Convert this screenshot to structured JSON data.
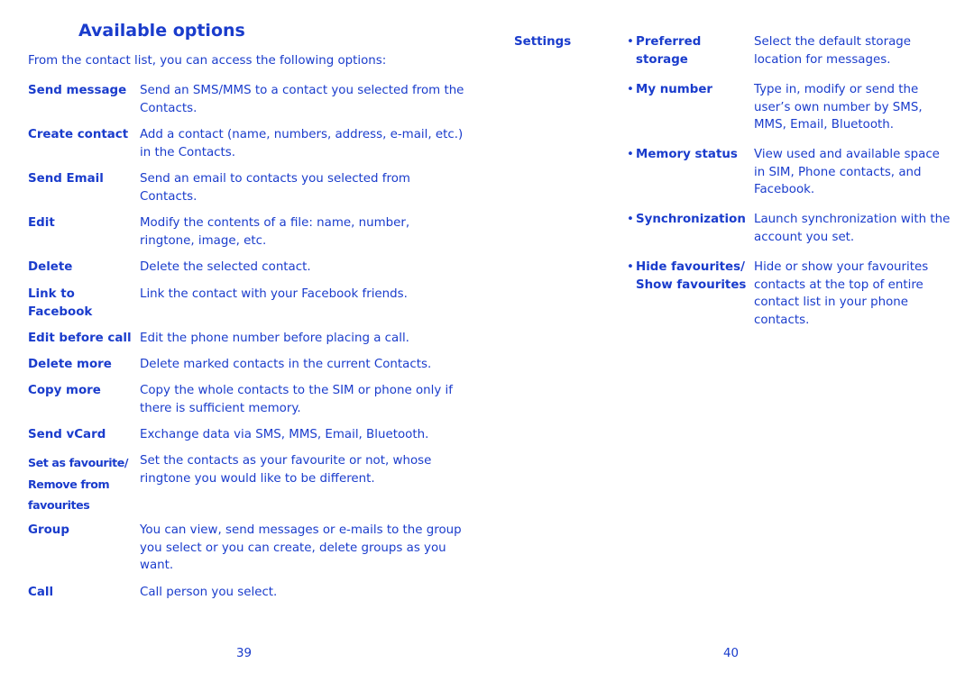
{
  "left_page": {
    "title": "Available options",
    "intro": "From the contact list, you can access the following options:",
    "options": [
      {
        "label": "Send message",
        "desc": "Send an SMS/MMS to a contact you selected from the Contacts."
      },
      {
        "label": "Create contact",
        "desc": "Add a contact (name, numbers, address, e-mail, etc.) in the Contacts."
      },
      {
        "label": "Send Email",
        "desc": "Send an email to contacts you selected from Contacts."
      },
      {
        "label": "Edit",
        "desc": "Modify the contents of a file: name, number, ringtone, image, etc."
      },
      {
        "label": "Delete",
        "desc": "Delete the selected contact."
      },
      {
        "label": "Link to Facebook",
        "desc": "Link the contact with your Facebook friends."
      },
      {
        "label": "Edit before call",
        "desc": "Edit the phone number before placing a call."
      },
      {
        "label": "Delete more",
        "desc": "Delete marked contacts in the current Contacts."
      },
      {
        "label": "Copy more",
        "desc": "Copy the whole contacts to the SIM or phone only if there is sufficient memory."
      },
      {
        "label": "Send vCard",
        "desc": "Exchange data via SMS, MMS, Email, Bluetooth."
      },
      {
        "label": "Set as favourite/ Remove from favourites",
        "desc": "Set the contacts as your favourite or not, whose ringtone you would like to be different."
      },
      {
        "label": "Group",
        "desc": "You can view, send messages or e-mails to the group you select or you can create, delete groups as you want."
      },
      {
        "label": "Call",
        "desc": "Call person you select."
      }
    ],
    "page_number": "39"
  },
  "right_page": {
    "section": "Settings",
    "bullet": "•",
    "items": [
      {
        "label": "Preferred storage",
        "desc": "Select the default storage location for messages."
      },
      {
        "label": "My number",
        "desc": "Type in, modify or send the user’s own number by SMS, MMS, Email, Bluetooth."
      },
      {
        "label": "Memory status",
        "desc": "View used and available space in SIM, Phone contacts, and Facebook."
      },
      {
        "label": "Synchronization",
        "desc": "Launch synchronization with the account you set."
      },
      {
        "label": "Hide favourites/ Show favourites",
        "desc": "Hide or show your favourites contacts at the top of entire contact list in your phone contacts."
      }
    ],
    "page_number": "40"
  },
  "colors": {
    "text": "#1a3ccc",
    "background": "#ffffff"
  }
}
